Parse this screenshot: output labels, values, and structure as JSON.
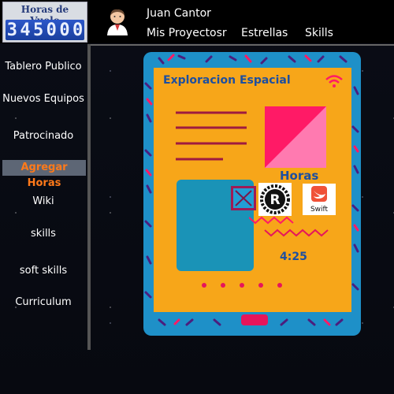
{
  "badge": {
    "title": "Horas de Vuelo",
    "digits": [
      "3",
      "4",
      "5",
      "0",
      "0",
      "0"
    ]
  },
  "user": {
    "name": "Juan Cantor"
  },
  "top_nav": [
    {
      "label": "Mis Proyectosr"
    },
    {
      "label": "Estrellas"
    },
    {
      "label": "Skills"
    }
  ],
  "sidebar": {
    "items": [
      {
        "label": "Tablero Publico"
      },
      {
        "label": "Nuevos Equipos"
      },
      {
        "label": "Patrocinado"
      },
      {
        "label": "Agregar Horas",
        "active": true
      },
      {
        "label": "Wiki"
      },
      {
        "label": "skills"
      },
      {
        "label": "soft skills"
      },
      {
        "label": "Curriculum"
      }
    ]
  },
  "card": {
    "title": "Exploracion Espacial",
    "hours_label": "Horas",
    "swift_label": "Swift",
    "time": "4:25"
  },
  "colors": {
    "tablet_blue": "#1e90c8",
    "screen_orange": "#f7a619",
    "pink": "#ff1a66",
    "accent_red": "#e6155b",
    "active_text": "#ff7a1a",
    "title_blue": "#1d4fa0"
  },
  "icons": {
    "wifi": "wifi-icon",
    "close": "close-icon",
    "rust": "rust-logo",
    "swift": "swift-logo"
  }
}
